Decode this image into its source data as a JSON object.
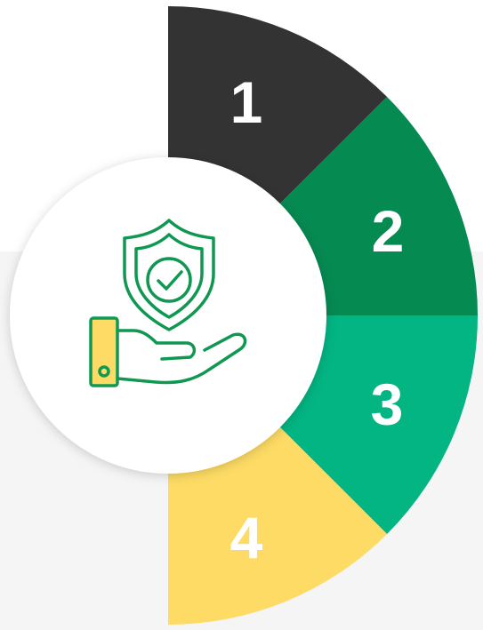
{
  "segments": [
    {
      "label": "1",
      "color": "#333333"
    },
    {
      "label": "2",
      "color": "#058a52"
    },
    {
      "label": "3",
      "color": "#02b583"
    },
    {
      "label": "4",
      "color": "#fddb64"
    }
  ],
  "center_icon": {
    "name": "hand-shield-check-icon",
    "stroke_color": "#109852",
    "fill_color": "#fddb64"
  }
}
